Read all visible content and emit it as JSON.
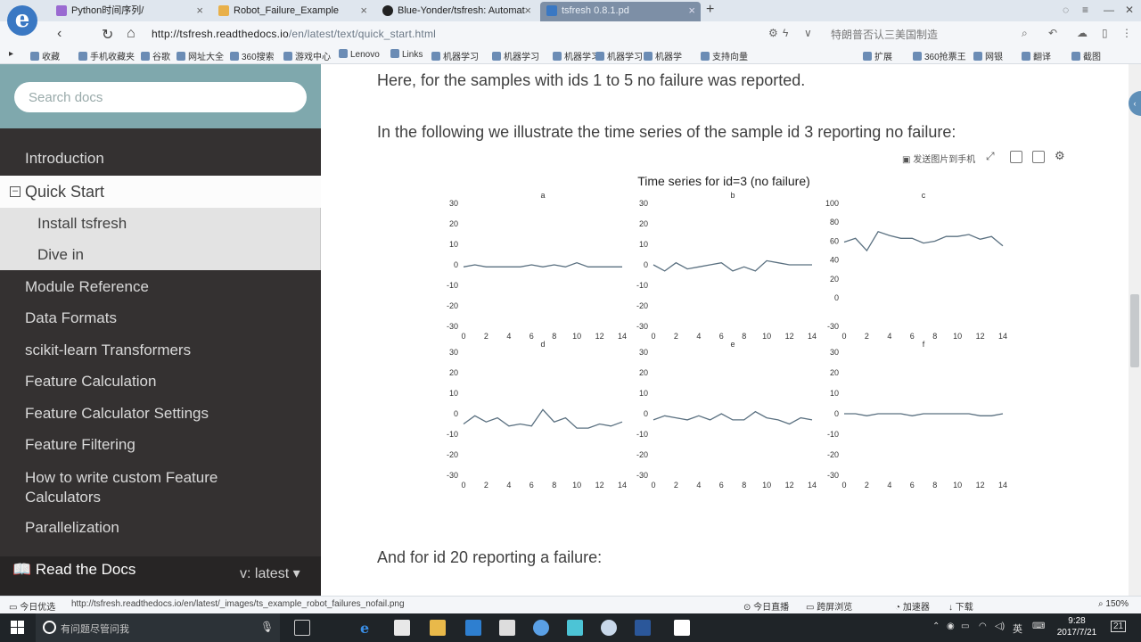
{
  "browser": {
    "tabs": [
      {
        "title": "Python时间序列/",
        "favicon_color": "#9a6ad1"
      },
      {
        "title": "Robot_Failure_Example",
        "favicon_color": "#e8b04a"
      },
      {
        "title": "Blue-Yonder/tsfresh: Automat",
        "favicon_color": "#222222"
      },
      {
        "title": "tsfresh 0.8.1.pd",
        "favicon_color": "#3a78c3",
        "active": true
      }
    ],
    "new_tab": "+",
    "url_host": "http://tsfresh.readthedocs.io",
    "url_path": "/en/latest/text/quick_start.html",
    "search_hint": "特朗普否认三美国制造",
    "bookmarks": [
      "收藏",
      "手机收藏夹",
      "谷歌",
      "网址大全",
      "360搜索",
      "游戏中心",
      "Lenovo",
      "Links",
      "机器学习",
      "机器学习",
      "机器学习",
      "机器学习",
      "机器学",
      "支持向量",
      "扩展",
      "360抢票王",
      "网银",
      "翻译",
      "截图"
    ]
  },
  "sidebar": {
    "search_placeholder": "Search docs",
    "items_top": [
      "Introduction"
    ],
    "current": "Quick Start",
    "current_marker": "–",
    "sub_items": [
      "Install tsfresh",
      "Dive in"
    ],
    "items_bottom": [
      "Module Reference",
      "Data Formats",
      "scikit-learn Transformers",
      "Feature Calculation",
      "Feature Calculator Settings",
      "Feature Filtering",
      "How to write custom Feature Calculators",
      "Parallelization"
    ],
    "footer_label": "Read the Docs",
    "version": "v: latest"
  },
  "content": {
    "para1": "Here, for the samples with ids 1 to 5 no failure was reported.",
    "para2": "In the following we illustrate the time series of the sample id 3 reporting no failure:",
    "para3": "And for id 20 reporting a failure:",
    "chart_toolbar_label": "发送图片到手机"
  },
  "chart_data": {
    "type": "line",
    "title": "Time series for id=3 (no failure)",
    "x": [
      0,
      1,
      2,
      3,
      4,
      5,
      6,
      7,
      8,
      9,
      10,
      11,
      12,
      13,
      14
    ],
    "xticks": [
      0,
      2,
      4,
      6,
      8,
      10,
      12,
      14
    ],
    "subplots": [
      {
        "name": "a",
        "ylim": [
          -30,
          30
        ],
        "yticks": [
          30,
          20,
          10,
          0,
          -10,
          -20,
          -30
        ],
        "values": [
          -1,
          0,
          -1,
          -1,
          -1,
          -1,
          0,
          -1,
          0,
          -1,
          1,
          -1,
          -1,
          -1,
          -1
        ]
      },
      {
        "name": "b",
        "ylim": [
          -30,
          30
        ],
        "yticks": [
          30,
          20,
          10,
          0,
          -10,
          -20,
          -30
        ],
        "values": [
          0,
          -3,
          1,
          -2,
          -1,
          0,
          1,
          -3,
          -1,
          -3,
          2,
          1,
          0,
          0,
          0
        ]
      },
      {
        "name": "c",
        "ylim": [
          -30,
          100
        ],
        "yticks": [
          100,
          80,
          60,
          40,
          20,
          0,
          -30
        ],
        "values": [
          59,
          63,
          50,
          70,
          66,
          63,
          63,
          58,
          60,
          65,
          65,
          67,
          62,
          65,
          55
        ]
      },
      {
        "name": "d",
        "ylim": [
          -30,
          30
        ],
        "yticks": [
          30,
          20,
          10,
          0,
          -10,
          -20,
          -30
        ],
        "values": [
          -5,
          -1,
          -4,
          -2,
          -6,
          -5,
          -6,
          2,
          -4,
          -2,
          -7,
          -7,
          -5,
          -6,
          -4
        ]
      },
      {
        "name": "e",
        "ylim": [
          -30,
          30
        ],
        "yticks": [
          30,
          20,
          10,
          0,
          -10,
          -20,
          -30
        ],
        "values": [
          -3,
          -1,
          -2,
          -3,
          -1,
          -3,
          0,
          -3,
          -3,
          1,
          -2,
          -3,
          -5,
          -2,
          -3
        ]
      },
      {
        "name": "f",
        "ylim": [
          -30,
          30
        ],
        "yticks": [
          30,
          20,
          10,
          0,
          -10,
          -20,
          -30
        ],
        "values": [
          0,
          0,
          -1,
          0,
          0,
          0,
          -1,
          0,
          0,
          0,
          0,
          0,
          -1,
          -1,
          0
        ]
      }
    ],
    "line_color": "#5a7080"
  },
  "statusbar": {
    "left": "今日优选",
    "link": "http://tsfresh.readthedocs.io/en/latest/_images/ts_example_robot_failures_nofail.png",
    "items": [
      "今日直播",
      "跨屏浏览",
      "加速器",
      "下载",
      "150%"
    ]
  },
  "taskbar": {
    "search_text": "有问题尽管问我",
    "ime": "英",
    "time": "9:28",
    "date": "2017/7/21",
    "notification_count": "21"
  }
}
